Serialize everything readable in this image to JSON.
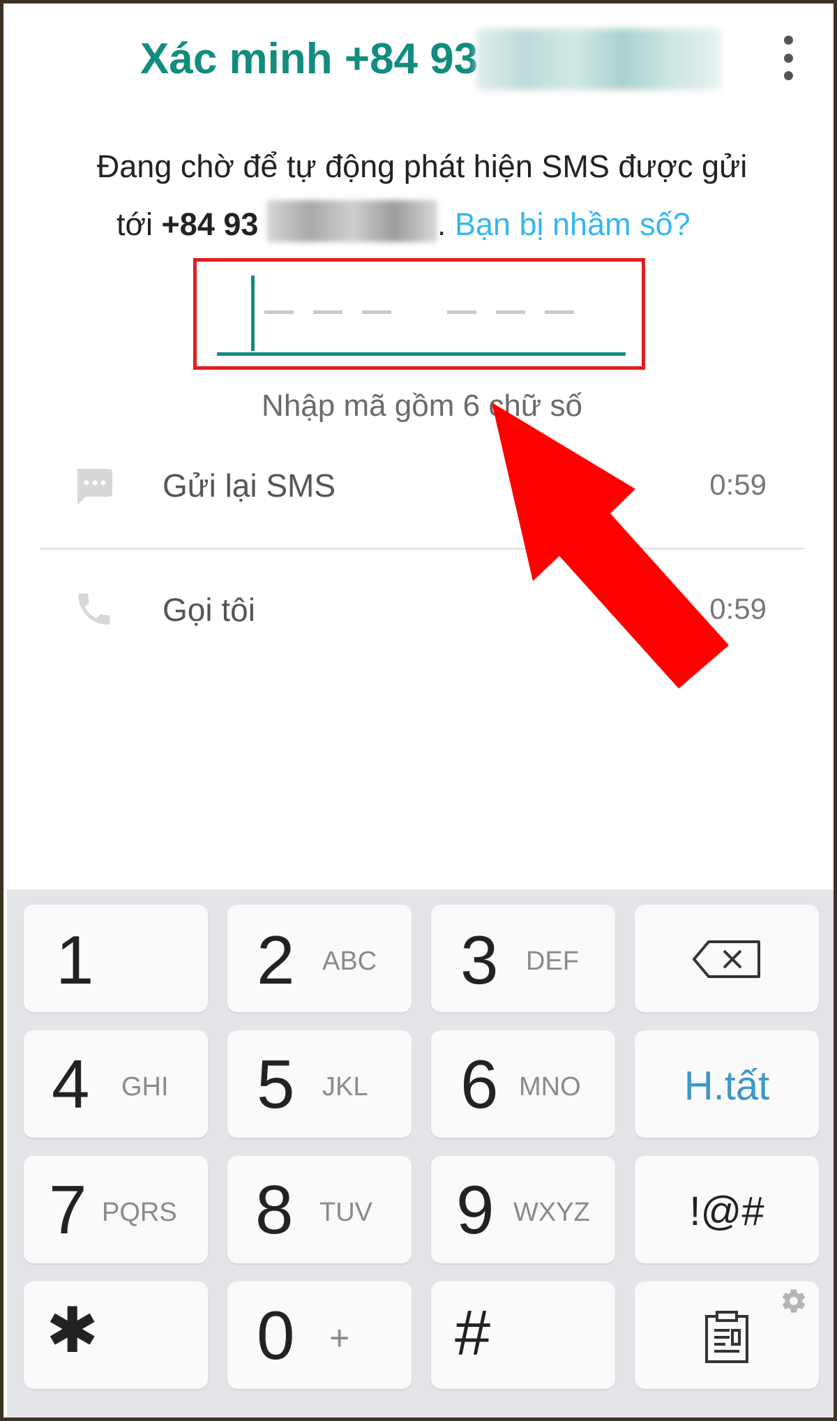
{
  "header": {
    "title": "Xác minh +84 93",
    "menu_icon": "more-vert-icon"
  },
  "description": {
    "line1": "Đang chờ để tự động phát hiện SMS được gửi",
    "prefix": "tới ",
    "phone": "+84 93",
    "suffix": ". ",
    "wrong_number_link": "Bạn bị nhầm số?"
  },
  "code_input": {
    "hint": "Nhập mã gồm 6 chữ số",
    "digits": 6
  },
  "options": [
    {
      "label": "Gửi lại SMS",
      "time": "0:59",
      "icon": "message-icon"
    },
    {
      "label": "Gọi tôi",
      "time": "0:59",
      "icon": "phone-icon"
    }
  ],
  "keyboard": {
    "keys": [
      {
        "digit": "1",
        "letters": ""
      },
      {
        "digit": "2",
        "letters": "ABC"
      },
      {
        "digit": "3",
        "letters": "DEF"
      },
      {
        "digit": "4",
        "letters": "GHI"
      },
      {
        "digit": "5",
        "letters": "JKL"
      },
      {
        "digit": "6",
        "letters": "MNO"
      },
      {
        "digit": "7",
        "letters": "PQRS"
      },
      {
        "digit": "8",
        "letters": "TUV"
      },
      {
        "digit": "9",
        "letters": "WXYZ"
      },
      {
        "digit": "✱",
        "letters": ""
      },
      {
        "digit": "0",
        "letters": "+"
      },
      {
        "digit": "#",
        "letters": ""
      }
    ],
    "backspace_icon": "backspace-icon",
    "done_label": "H.tất",
    "symbols_label": "!@#",
    "clipboard_icon": "clipboard-icon",
    "settings_icon": "gear-icon"
  },
  "colors": {
    "accent": "#128c7e",
    "link": "#34b7f1",
    "highlight": "#e31d1d",
    "arrow": "#ff0000",
    "done": "#3d97c5"
  }
}
